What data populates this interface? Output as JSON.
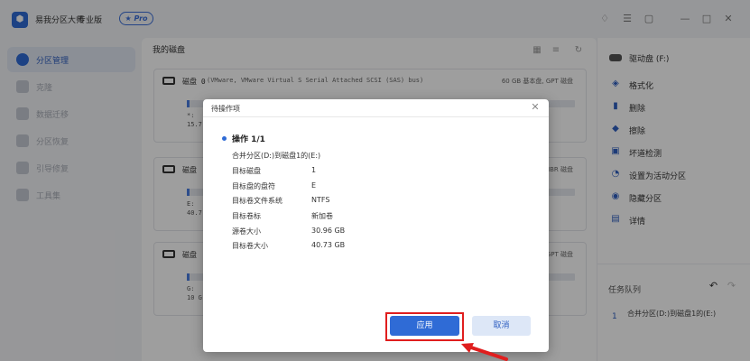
{
  "app": {
    "title": "易我分区大师",
    "edition": "专业版",
    "pro_badge": "Pro"
  },
  "sidebar": {
    "items": [
      {
        "label": "分区管理",
        "active": true
      },
      {
        "label": "克隆",
        "active": false
      },
      {
        "label": "数据迁移",
        "active": false
      },
      {
        "label": "分区恢复",
        "active": false
      },
      {
        "label": "引导修复",
        "active": false
      },
      {
        "label": "工具集",
        "active": false
      }
    ]
  },
  "main": {
    "title": "我的磁盘",
    "disks": [
      {
        "name": "磁盘 0",
        "desc": "(VMware,  VMware Virtual S Serial Attached SCSI (SAS) bus)",
        "info": "60 GB 基本盘, GPT 磁盘",
        "part_line1": "*:",
        "part_line2": "15.7",
        "side_label1": "(NT",
        "side_label2": "GB"
      },
      {
        "name": "磁盘",
        "desc": "",
        "info": "MBR 磁盘",
        "part_line1": "E: ",
        "part_line2": "40.7",
        "side_label1": "",
        "side_label2": ""
      },
      {
        "name": "磁盘",
        "desc": "",
        "info": "GPT 磁盘",
        "part_line1": "G: ",
        "part_line2": "10 G",
        "side_label1": "",
        "side_label2": ""
      }
    ]
  },
  "right_panel": {
    "header": "驱动盘 (F:)",
    "actions": [
      {
        "label": "格式化",
        "icon": "format-icon"
      },
      {
        "label": "删除",
        "icon": "trash-icon"
      },
      {
        "label": "擦除",
        "icon": "eraser-icon"
      },
      {
        "label": "坏道检测",
        "icon": "scan-icon"
      },
      {
        "label": "设置为活动分区",
        "icon": "active-partition-icon"
      },
      {
        "label": "隐藏分区",
        "icon": "hide-icon"
      },
      {
        "label": "详情",
        "icon": "details-icon"
      }
    ],
    "queue_title": "任务队列",
    "queue_item_number": "1",
    "queue_item_text": "合并分区(D:)到磁盘1的(E:)"
  },
  "modal": {
    "title": "待操作项",
    "op_header": "操作 1/1",
    "op_desc": "合并分区(D:)到磁盘1的(E:)",
    "rows": [
      {
        "label": "目标磁盘",
        "value": "1"
      },
      {
        "label": "目标盘的盘符",
        "value": "E"
      },
      {
        "label": "目标卷文件系统",
        "value": "NTFS"
      },
      {
        "label": "目标卷标",
        "value": "新加卷"
      },
      {
        "label": "源卷大小",
        "value": "30.96 GB"
      },
      {
        "label": "目标卷大小",
        "value": "40.73 GB"
      }
    ],
    "apply_label": "应用",
    "cancel_label": "取消"
  },
  "colors": {
    "accent": "#2f6bd6",
    "highlight": "#e01e1e"
  }
}
